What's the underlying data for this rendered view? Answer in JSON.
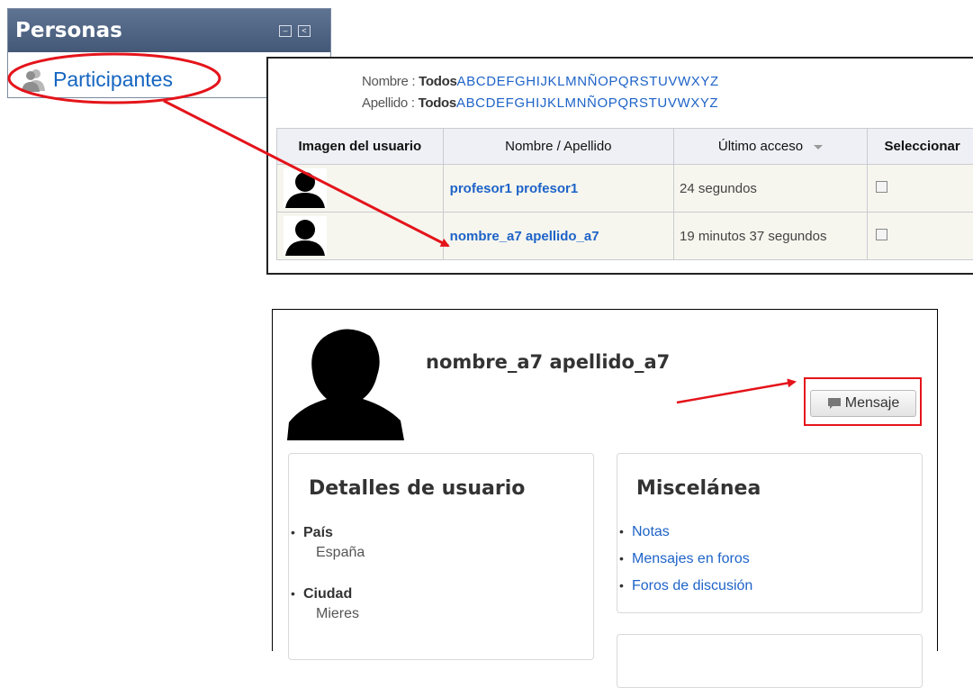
{
  "block": {
    "title": "Personas",
    "participants_label": "Participantes"
  },
  "filters": {
    "first_name_label": "Nombre : ",
    "last_name_label": "Apellido : ",
    "all_label": "Todos",
    "letters": "ABCDEFGHIJKLMNÑOPQRSTUVWXYZ"
  },
  "table": {
    "headers": [
      "Imagen del usuario",
      "Nombre / Apellido",
      "Último acceso",
      "Seleccionar"
    ],
    "rows": [
      {
        "name": "profesor1 profesor1",
        "last_access": "24 segundos"
      },
      {
        "name": "nombre_a7 apellido_a7",
        "last_access": "19 minutos 37 segundos"
      }
    ]
  },
  "profile": {
    "name": "nombre_a7 apellido_a7",
    "message_button": "Mensaje",
    "details": {
      "title": "Detalles de usuario",
      "fields": [
        {
          "label": "País",
          "value": "España"
        },
        {
          "label": "Ciudad",
          "value": "Mieres"
        }
      ]
    },
    "misc": {
      "title": "Miscelánea",
      "links": [
        "Notas",
        "Mensajes en foros",
        "Foros de discusión"
      ]
    }
  },
  "colors": {
    "link": "#1e63c8",
    "annotation": "#e4141b",
    "header": "#4b5f80"
  }
}
